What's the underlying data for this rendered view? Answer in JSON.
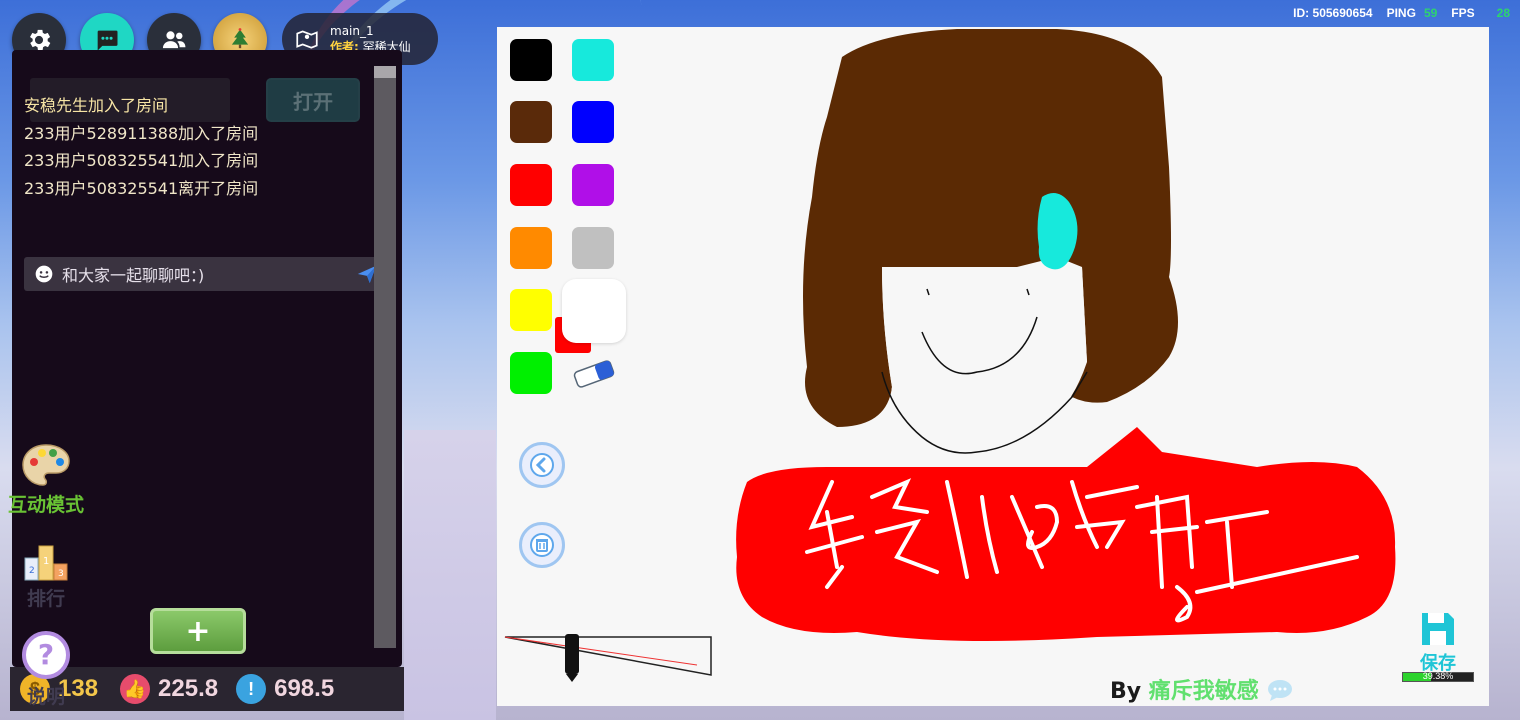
{
  "status": {
    "id_label": "ID:",
    "id_value": "505690654",
    "ping_label": "PING",
    "ping_value": "59",
    "fps_label": "FPS",
    "fps_value": "28"
  },
  "map": {
    "name": "main_1",
    "author_label": "作者:",
    "author_name": "罕稀大仙"
  },
  "chat": {
    "open_button": "打开",
    "messages": [
      "安稳先生加入了房间",
      "233用户528911388加入了房间",
      "233用户508325541加入了房间",
      "233用户508325541离开了房间"
    ],
    "input_placeholder": "和大家一起聊聊吧：)",
    "add_button": "+"
  },
  "stats": {
    "coins": "138",
    "likes": "225.8",
    "popularity": "698.5"
  },
  "side": {
    "mode_label": "互动模式",
    "rank_label": "排行",
    "help_label": "说明"
  },
  "canvas": {
    "by_prefix": "By",
    "by_author": "痛斥我敏感",
    "save_label": "保存",
    "save_progress_text": "39.38%",
    "save_progress": 0.3938,
    "palette": [
      "#000000",
      "#17e9dc",
      "#5a2a0a",
      "#0000ff",
      "#ff0000",
      "#b00fe8",
      "#ff8a00",
      "#c0c0c0",
      "#ffff00",
      "#ffffff",
      "#00f000"
    ],
    "accent": "#ff0000"
  }
}
